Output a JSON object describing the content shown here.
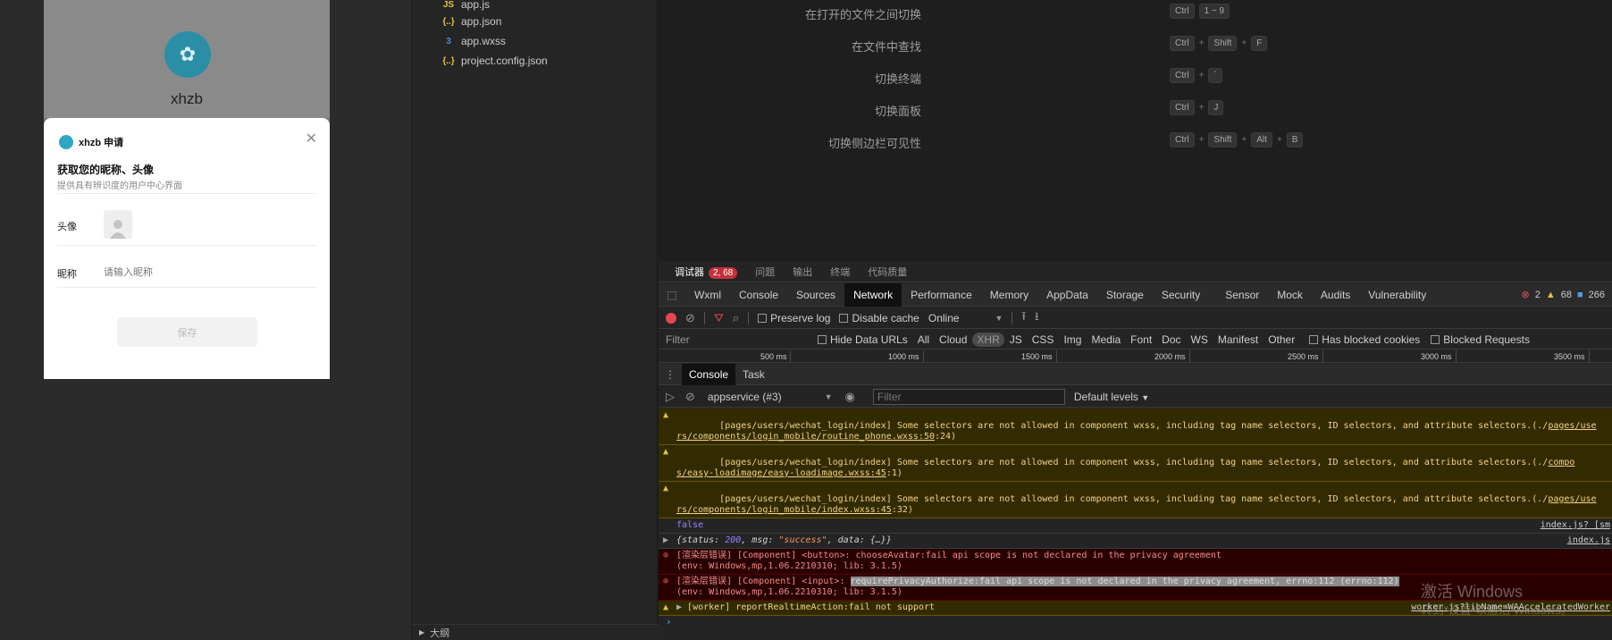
{
  "simulator": {
    "app_name": "xhzb",
    "sheet": {
      "title": "xhzb 申请",
      "heading": "获取您的昵称、头像",
      "subheading": "提供具有辨识度的用户中心界面",
      "avatar_label": "头像",
      "nickname_label": "昵称",
      "nickname_placeholder": "请输入昵称",
      "save_label": "保存"
    }
  },
  "file_tree": {
    "items": [
      {
        "name": "app.js",
        "icon": "js-icon"
      },
      {
        "name": "app.json",
        "icon": "json-icon"
      },
      {
        "name": "app.wxss",
        "icon": "css-icon"
      },
      {
        "name": "project.config.json",
        "icon": "json-icon"
      }
    ],
    "outline_label": "大纲"
  },
  "shortcuts": [
    {
      "label": "在打开的文件之间切换",
      "keys": [
        "Ctrl",
        "1 ~ 9"
      ]
    },
    {
      "label": "在文件中查找",
      "keys": [
        "Ctrl",
        "Shift",
        "F"
      ]
    },
    {
      "label": "切换终端",
      "keys": [
        "Ctrl",
        "`"
      ]
    },
    {
      "label": "切换面板",
      "keys": [
        "Ctrl",
        "J"
      ]
    },
    {
      "label": "切换侧边栏可见性",
      "keys": [
        "Ctrl",
        "Shift",
        "Alt",
        "B"
      ]
    }
  ],
  "devtools": {
    "top_tabs": [
      "调试器",
      "问题",
      "输出",
      "终端",
      "代码质量"
    ],
    "debugger_badge": "2, 68",
    "panel_tabs": [
      "Wxml",
      "Console",
      "Sources",
      "Network",
      "Performance",
      "Memory",
      "AppData",
      "Storage",
      "Security",
      "Sensor",
      "Mock",
      "Audits",
      "Vulnerability"
    ],
    "active_panel": "Network",
    "counts": {
      "errors": "2",
      "warnings": "68",
      "info": "266"
    },
    "network_toolbar": {
      "preserve_log": "Preserve log",
      "disable_cache": "Disable cache",
      "throttle": "Online"
    },
    "filter_bar": {
      "filter_placeholder": "Filter",
      "hide_data_urls": "Hide Data URLs",
      "types": [
        "All",
        "Cloud",
        "XHR",
        "JS",
        "CSS",
        "Img",
        "Media",
        "Font",
        "Doc",
        "WS",
        "Manifest",
        "Other"
      ],
      "active_type": "XHR",
      "has_blocked_cookies": "Has blocked cookies",
      "blocked_requests": "Blocked Requests"
    },
    "timeline_ticks": [
      "500 ms",
      "1000 ms",
      "1500 ms",
      "2000 ms",
      "2500 ms",
      "3000 ms",
      "3500 ms"
    ],
    "drawer_tabs": [
      "Console",
      "Task"
    ],
    "console_toolbar": {
      "context": "appservice (#3)",
      "filter_placeholder": "Filter",
      "levels": "Default levels"
    },
    "logs": {
      "w1_line1": "[pages/users/wechat_login/index] Some selectors are not allowed in component wxss, including tag name selectors, ID selectors, and attribute selectors.(./",
      "w1_link1": "pages/use",
      "w1_line2a": "rs/components/login_mobile/routine_phone.wxss:50",
      "w1_line2b": ":24)",
      "w2_line1": "[pages/users/wechat_login/index] Some selectors are not allowed in component wxss, including tag name selectors, ID selectors, and attribute selectors.(./",
      "w2_link1": "compo",
      "w2_line2a": "s/easy-loadimage/easy-loadimage.wxss:45",
      "w2_line2b": ":1)",
      "w3_line1": "[pages/users/wechat_login/index] Some selectors are not allowed in component wxss, including tag name selectors, ID selectors, and attribute selectors.(./",
      "w3_link1": "pages/use",
      "w3_line2a": "rs/components/login_mobile/index.wxss:45",
      "w3_line2b": ":32)",
      "p1_text": "false",
      "p1_src": "index.js? [sm",
      "p2_open": "{status: ",
      "p2_status": "200",
      "p2_mid": ", msg: ",
      "p2_msg": "\"success\"",
      "p2_end": ", data: {…}}",
      "p2_src": "index.js",
      "e1_line1": "[渲染层错误] [Component] <button>: chooseAvatar:fail api scope is not declared in the privacy agreement",
      "e1_line2": "(env: Windows,mp,1.06.2210310; lib: 3.1.5)",
      "e2_prefix": "[渲染层错误] [Component] <input>: ",
      "e2_highlight": "requirePrivacyAuthorize:fail api scope is not declared in the privacy agreement, errno:112 (errno:112)",
      "e2_line2": "(env: Windows,mp,1.06.2210310; lib: 3.1.5)",
      "w4_line1": "[worker] reportRealtimeAction:fail not support",
      "w4_src": "worker.js?libName=WAAcceleratedWorker"
    }
  },
  "watermark": {
    "line1": "激活 Windows",
    "line2": "转到\"设置\"以激活 Windows。"
  }
}
